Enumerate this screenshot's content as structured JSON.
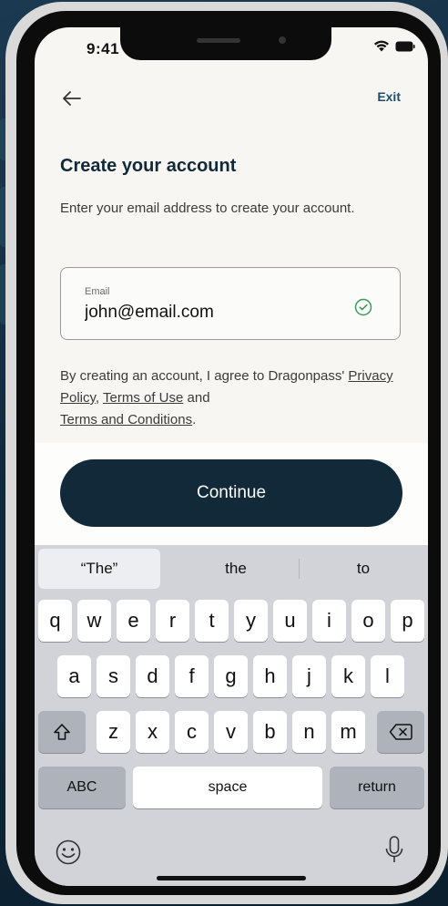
{
  "status": {
    "time": "9:41"
  },
  "nav": {
    "exit_label": "Exit"
  },
  "page": {
    "title": "Create your account",
    "subtitle": "Enter your email address to create your account."
  },
  "email": {
    "label": "Email",
    "value": "john@email.com"
  },
  "terms": {
    "prefix": "By creating an account, I agree to Dragonpass' ",
    "privacy": "Privacy Policy",
    "sep": ", ",
    "terms_of_use": "Terms of Use",
    "and": " and",
    "terms_conditions": "Terms and Conditions",
    "suffix": "."
  },
  "continue_label": "Continue",
  "keyboard": {
    "suggestions": [
      "“The”",
      "the",
      "to"
    ],
    "row1": [
      "q",
      "w",
      "e",
      "r",
      "t",
      "y",
      "u",
      "i",
      "o",
      "p"
    ],
    "row2": [
      "a",
      "s",
      "d",
      "f",
      "g",
      "h",
      "j",
      "k",
      "l"
    ],
    "row3": [
      "z",
      "x",
      "c",
      "v",
      "b",
      "n",
      "m"
    ],
    "abc_label": "ABC",
    "space_label": "space",
    "return_label": "return"
  },
  "colors": {
    "primary": "#12293a",
    "accent_check": "#3a9a5b",
    "link": "#1c4e6e"
  }
}
